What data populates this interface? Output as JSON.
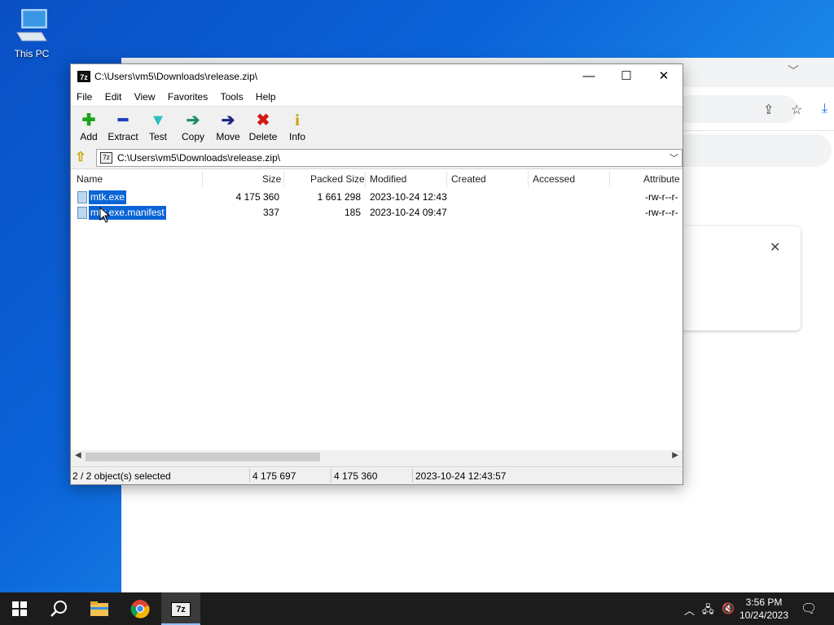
{
  "desktop": {
    "this_pc_label": "This PC"
  },
  "window": {
    "title": "C:\\Users\\vm5\\Downloads\\release.zip\\",
    "app_icon": "7z",
    "controls": {
      "minimize": "—",
      "maximize": "☐",
      "close": "✕"
    }
  },
  "menu": [
    "File",
    "Edit",
    "View",
    "Favorites",
    "Tools",
    "Help"
  ],
  "toolbar": [
    {
      "label": "Add",
      "glyph": "✚",
      "color": "#1aa31a"
    },
    {
      "label": "Extract",
      "glyph": "━",
      "color": "#1c3fbf"
    },
    {
      "label": "Test",
      "glyph": "▼",
      "color": "#2bbfbf"
    },
    {
      "label": "Copy",
      "glyph": "➔",
      "color": "#1e8b6e"
    },
    {
      "label": "Move",
      "glyph": "➔",
      "color": "#1a237e"
    },
    {
      "label": "Delete",
      "glyph": "✖",
      "color": "#d11a1a"
    },
    {
      "label": "Info",
      "glyph": "i",
      "color": "#c7a000"
    }
  ],
  "address": {
    "path": "C:\\Users\\vm5\\Downloads\\release.zip\\"
  },
  "columns": [
    "Name",
    "Size",
    "Packed Size",
    "Modified",
    "Created",
    "Accessed",
    "Attribute"
  ],
  "files": [
    {
      "name": "mtk.exe",
      "size": "4 175 360",
      "packed": "1 661 298",
      "modified": "2023-10-24 12:43",
      "created": "",
      "accessed": "",
      "attr": "-rw-r--r-"
    },
    {
      "name": "mtk.exe.manifest",
      "size": "337",
      "packed": "185",
      "modified": "2023-10-24 09:47",
      "created": "",
      "accessed": "",
      "attr": "-rw-r--r-"
    }
  ],
  "status": {
    "selected": "2 / 2 object(s) selected",
    "total_size": "4 175 697",
    "packed_size": "4 175 360",
    "date": "2023-10-24 12:43:57"
  },
  "taskbar": {
    "items": [
      "start-icon",
      "search-icon",
      "file-explorer-icon",
      "chrome-icon",
      "7zip-icon"
    ],
    "active": "7zip-icon",
    "time": "3:56 PM",
    "date": "10/24/2023"
  }
}
